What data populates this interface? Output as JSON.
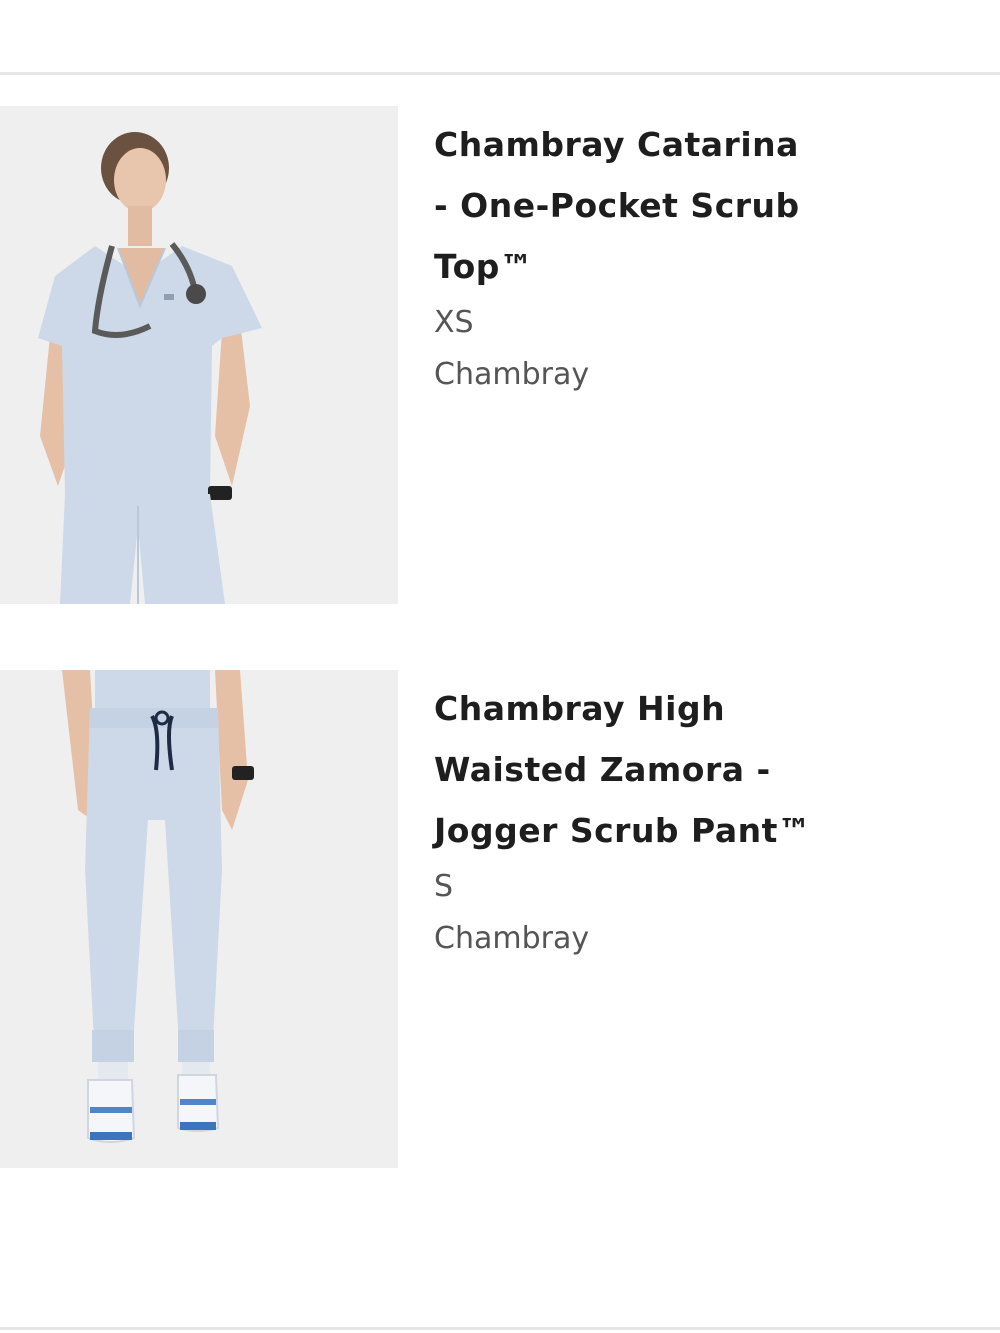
{
  "cart": {
    "items": [
      {
        "title": "Chambray Catarina - One-Pocket Scrub Top™",
        "size": "XS",
        "color_name": "Chambray",
        "image": "scrub-top-model-photo"
      },
      {
        "title": "Chambray High Waisted Zamora - Jogger Scrub Pant™",
        "size": "S",
        "color_name": "Chambray",
        "image": "jogger-pant-model-photo"
      }
    ]
  },
  "colors": {
    "chambray": "#cdd9e8",
    "background": "#ffffff",
    "divider": "#e6e6e6",
    "title_text": "#1e1e1e",
    "meta_text": "#555555"
  }
}
